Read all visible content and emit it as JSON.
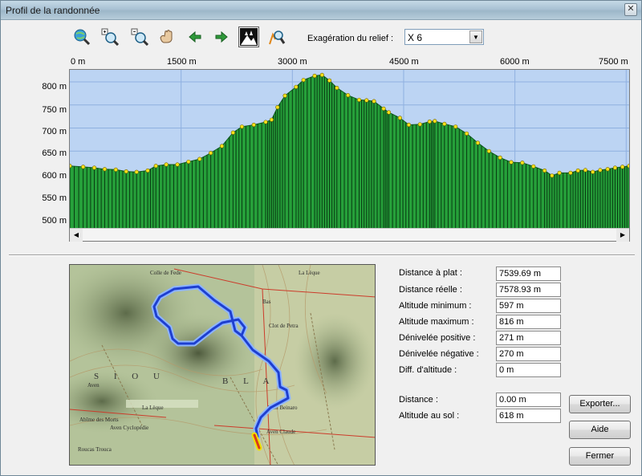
{
  "window": {
    "title": "Profil de la randonnée",
    "close": "✕"
  },
  "toolbar": {
    "exaggeration_label": "Exagération du relief :",
    "exaggeration_value": "X 6"
  },
  "chart_data": {
    "type": "area",
    "x_tick_labels": [
      "0 m",
      "1500 m",
      "3000 m",
      "4500 m",
      "6000 m",
      "7500 m"
    ],
    "y_tick_labels": [
      "800 m",
      "750 m",
      "700 m",
      "650 m",
      "600 m",
      "550 m",
      "500 m"
    ],
    "x_range": [
      0,
      7540
    ],
    "y_range": [
      482,
      826
    ],
    "x_unit": "m",
    "y_unit": "m",
    "fill_color": "#26a03a",
    "background_color": "#bcd4f3",
    "marker_color": "#f5e11a",
    "profile": [
      {
        "x": 0,
        "y": 618
      },
      {
        "x": 180,
        "y": 616
      },
      {
        "x": 330,
        "y": 614
      },
      {
        "x": 470,
        "y": 611
      },
      {
        "x": 620,
        "y": 610
      },
      {
        "x": 760,
        "y": 606
      },
      {
        "x": 900,
        "y": 605
      },
      {
        "x": 1050,
        "y": 608
      },
      {
        "x": 1160,
        "y": 618
      },
      {
        "x": 1300,
        "y": 621
      },
      {
        "x": 1450,
        "y": 621
      },
      {
        "x": 1600,
        "y": 627
      },
      {
        "x": 1750,
        "y": 633
      },
      {
        "x": 1900,
        "y": 646
      },
      {
        "x": 2050,
        "y": 661
      },
      {
        "x": 2200,
        "y": 690
      },
      {
        "x": 2320,
        "y": 703
      },
      {
        "x": 2480,
        "y": 707
      },
      {
        "x": 2640,
        "y": 713
      },
      {
        "x": 2720,
        "y": 718
      },
      {
        "x": 2800,
        "y": 745
      },
      {
        "x": 2900,
        "y": 770
      },
      {
        "x": 3050,
        "y": 789
      },
      {
        "x": 3150,
        "y": 804
      },
      {
        "x": 3300,
        "y": 813
      },
      {
        "x": 3400,
        "y": 815
      },
      {
        "x": 3500,
        "y": 803
      },
      {
        "x": 3600,
        "y": 787
      },
      {
        "x": 3750,
        "y": 771
      },
      {
        "x": 3900,
        "y": 761
      },
      {
        "x": 4000,
        "y": 760
      },
      {
        "x": 4100,
        "y": 758
      },
      {
        "x": 4230,
        "y": 742
      },
      {
        "x": 4300,
        "y": 734
      },
      {
        "x": 4450,
        "y": 722
      },
      {
        "x": 4570,
        "y": 707
      },
      {
        "x": 4720,
        "y": 708
      },
      {
        "x": 4850,
        "y": 714
      },
      {
        "x": 4920,
        "y": 715
      },
      {
        "x": 5050,
        "y": 709
      },
      {
        "x": 5200,
        "y": 703
      },
      {
        "x": 5350,
        "y": 688
      },
      {
        "x": 5500,
        "y": 668
      },
      {
        "x": 5650,
        "y": 650
      },
      {
        "x": 5800,
        "y": 636
      },
      {
        "x": 5950,
        "y": 626
      },
      {
        "x": 6100,
        "y": 625
      },
      {
        "x": 6250,
        "y": 617
      },
      {
        "x": 6400,
        "y": 608
      },
      {
        "x": 6500,
        "y": 597
      },
      {
        "x": 6600,
        "y": 603
      },
      {
        "x": 6750,
        "y": 603
      },
      {
        "x": 6850,
        "y": 608
      },
      {
        "x": 6950,
        "y": 609
      },
      {
        "x": 7050,
        "y": 605
      },
      {
        "x": 7150,
        "y": 609
      },
      {
        "x": 7250,
        "y": 611
      },
      {
        "x": 7350,
        "y": 614
      },
      {
        "x": 7450,
        "y": 616
      },
      {
        "x": 7540,
        "y": 618
      }
    ]
  },
  "stats": [
    {
      "label": "Distance à plat :",
      "value": "7539.69 m"
    },
    {
      "label": "Distance réelle :",
      "value": "7578.93 m"
    },
    {
      "label": "Altitude minimum :",
      "value": "597 m"
    },
    {
      "label": "Altitude maximum :",
      "value": "816 m"
    },
    {
      "label": "Dénivelée positive :",
      "value": "271 m"
    },
    {
      "label": "Dénivelée négative :",
      "value": "270 m"
    },
    {
      "label": "Diff. d'altitude :",
      "value": "0 m"
    }
  ],
  "cursor": [
    {
      "label": "Distance :",
      "value": "0.00 m"
    },
    {
      "label": "Altitude au sol :",
      "value": "618 m"
    }
  ],
  "buttons": {
    "export": "Exporter...",
    "help": "Aide",
    "close": "Fermer"
  },
  "map": {
    "route_color": "#2a4fd8",
    "map_labels": [
      "Colle de Fede",
      "La Lèque",
      "Bas",
      "Clot de Petra",
      "S I O U",
      "B L A",
      "Aven",
      "Aven Beinaro",
      "Aven Claude",
      "Roucas Trouca",
      "Abîme des Morts",
      "Aven Cyclopédie",
      "La Lèque"
    ]
  }
}
